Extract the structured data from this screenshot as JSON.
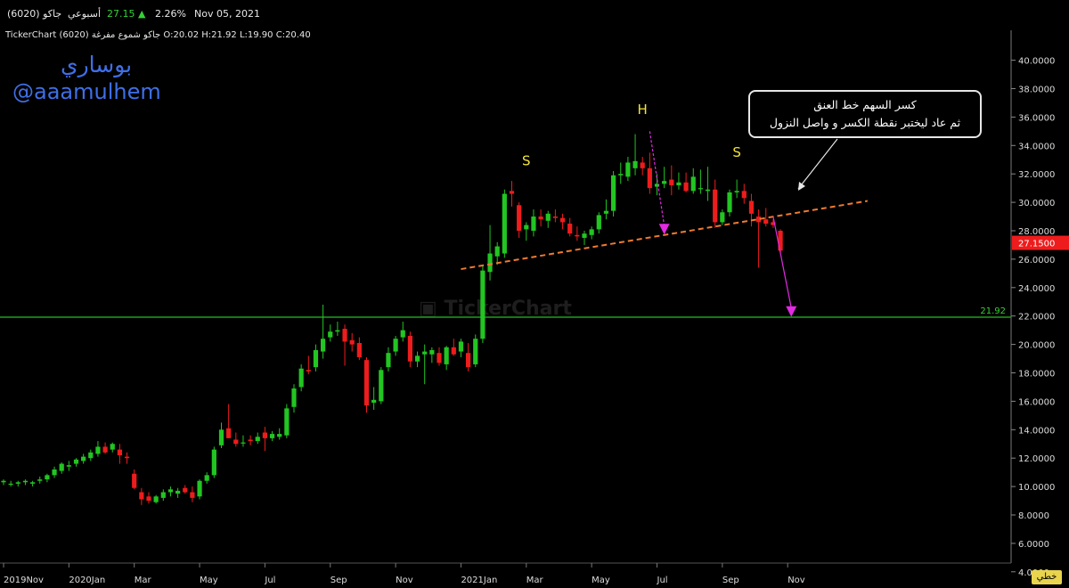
{
  "header": {
    "symbol": "(6020) جاكو",
    "timeframe": "أسبوعي",
    "price": "27.15",
    "change_pct": "2.26%",
    "date": "Nov 05, 2021",
    "ohlc": "TickerChart جاكو شموع مفرغة (6020) O:20.02 H:21.92 L:19.90 C:20.40"
  },
  "watermark": {
    "name": "بوساري",
    "handle": "@aaamulhem"
  },
  "callout": {
    "line1": "كسر السهم خط العنق",
    "line2": "ثم عاد ليختبر نقطة الكسر و واصل النزول"
  },
  "colors": {
    "up": "#22c522",
    "down": "#ee1c1c",
    "background": "#000000",
    "hline": "#1ea01e",
    "trend": "#f07a30",
    "arrow": "#e22be2",
    "letters": "#f2e33a",
    "price_tag": "#ee1c1c"
  },
  "bottom_button": "خطي",
  "chart_data": {
    "type": "candlestick",
    "title": "",
    "xlabel": "",
    "ylabel": "",
    "ylim": [
      3,
      41
    ],
    "y_ticks": [
      "4.0000",
      "6.0000",
      "8.0000",
      "10.0000",
      "12.0000",
      "14.0000",
      "16.0000",
      "18.0000",
      "20.0000",
      "22.0000",
      "24.0000",
      "26.0000",
      "28.0000",
      "30.0000",
      "32.0000",
      "34.0000",
      "36.0000",
      "38.0000",
      "40.0000"
    ],
    "x_ticks": [
      "2019Nov",
      "2020Jan",
      "Mar",
      "May",
      "Jul",
      "Sep",
      "Nov",
      "2021Jan",
      "Mar",
      "May",
      "Jul",
      "Sep",
      "Nov"
    ],
    "last_price_label": "27.1500",
    "horizontal_line": {
      "value": 21.92,
      "label": "21.92"
    },
    "pattern_labels": [
      {
        "text": "S",
        "x_week": 72,
        "y": 32.6
      },
      {
        "text": "H",
        "x_week": 88,
        "y": 36.2
      },
      {
        "text": "S",
        "x_week": 101,
        "y": 33.2
      }
    ],
    "neckline": {
      "from": [
        63,
        25.3
      ],
      "to": [
        119,
        30.1
      ]
    },
    "arrows": [
      {
        "from": [
          89,
          35.0
        ],
        "to": [
          91,
          27.8
        ]
      },
      {
        "from": [
          106,
          29.0
        ],
        "to": [
          108.5,
          22.0
        ]
      }
    ],
    "candles": [
      {
        "o": 10.3,
        "h": 10.5,
        "l": 10.1,
        "c": 10.4
      },
      {
        "o": 10.2,
        "h": 10.4,
        "l": 10.0,
        "c": 10.2
      },
      {
        "o": 10.2,
        "h": 10.4,
        "l": 10.0,
        "c": 10.3
      },
      {
        "o": 10.3,
        "h": 10.5,
        "l": 10.1,
        "c": 10.4
      },
      {
        "o": 10.2,
        "h": 10.4,
        "l": 10.0,
        "c": 10.3
      },
      {
        "o": 10.4,
        "h": 10.7,
        "l": 10.2,
        "c": 10.5
      },
      {
        "o": 10.5,
        "h": 10.9,
        "l": 10.3,
        "c": 10.8
      },
      {
        "o": 10.8,
        "h": 11.4,
        "l": 10.6,
        "c": 11.2
      },
      {
        "o": 11.1,
        "h": 11.7,
        "l": 10.9,
        "c": 11.6
      },
      {
        "o": 11.4,
        "h": 11.8,
        "l": 11.1,
        "c": 11.5
      },
      {
        "o": 11.6,
        "h": 12.0,
        "l": 11.4,
        "c": 11.9
      },
      {
        "o": 11.8,
        "h": 12.3,
        "l": 11.6,
        "c": 12.1
      },
      {
        "o": 12.0,
        "h": 12.6,
        "l": 11.8,
        "c": 12.4
      },
      {
        "o": 12.3,
        "h": 13.2,
        "l": 12.1,
        "c": 12.8
      },
      {
        "o": 12.8,
        "h": 13.1,
        "l": 12.3,
        "c": 12.4
      },
      {
        "o": 12.6,
        "h": 13.1,
        "l": 12.4,
        "c": 13.0
      },
      {
        "o": 12.6,
        "h": 13.0,
        "l": 11.6,
        "c": 12.2
      },
      {
        "o": 12.1,
        "h": 12.4,
        "l": 11.6,
        "c": 12.0
      },
      {
        "o": 10.9,
        "h": 11.2,
        "l": 9.8,
        "c": 9.9
      },
      {
        "o": 9.6,
        "h": 9.9,
        "l": 8.7,
        "c": 9.1
      },
      {
        "o": 9.3,
        "h": 9.6,
        "l": 8.8,
        "c": 9.0
      },
      {
        "o": 8.9,
        "h": 9.4,
        "l": 8.8,
        "c": 9.3
      },
      {
        "o": 9.2,
        "h": 9.8,
        "l": 9.0,
        "c": 9.6
      },
      {
        "o": 9.6,
        "h": 10.0,
        "l": 9.3,
        "c": 9.8
      },
      {
        "o": 9.5,
        "h": 9.9,
        "l": 9.2,
        "c": 9.7
      },
      {
        "o": 9.9,
        "h": 10.1,
        "l": 9.5,
        "c": 9.6
      },
      {
        "o": 9.6,
        "h": 10.0,
        "l": 8.9,
        "c": 9.2
      },
      {
        "o": 9.3,
        "h": 10.5,
        "l": 9.1,
        "c": 10.4
      },
      {
        "o": 10.4,
        "h": 11.0,
        "l": 10.2,
        "c": 10.8
      },
      {
        "o": 10.8,
        "h": 12.8,
        "l": 10.6,
        "c": 12.6
      },
      {
        "o": 12.9,
        "h": 14.5,
        "l": 12.7,
        "c": 14.0
      },
      {
        "o": 14.1,
        "h": 15.8,
        "l": 13.4,
        "c": 13.4
      },
      {
        "o": 13.3,
        "h": 13.8,
        "l": 12.8,
        "c": 13.0
      },
      {
        "o": 13.1,
        "h": 13.6,
        "l": 12.8,
        "c": 13.1
      },
      {
        "o": 13.3,
        "h": 13.6,
        "l": 12.9,
        "c": 13.2
      },
      {
        "o": 13.2,
        "h": 13.8,
        "l": 13.0,
        "c": 13.5
      },
      {
        "o": 13.8,
        "h": 14.2,
        "l": 12.5,
        "c": 13.4
      },
      {
        "o": 13.4,
        "h": 13.9,
        "l": 13.2,
        "c": 13.7
      },
      {
        "o": 13.5,
        "h": 14.1,
        "l": 13.3,
        "c": 13.7
      },
      {
        "o": 13.6,
        "h": 15.8,
        "l": 13.4,
        "c": 15.5
      },
      {
        "o": 15.6,
        "h": 17.2,
        "l": 15.2,
        "c": 16.9
      },
      {
        "o": 17.0,
        "h": 18.6,
        "l": 16.7,
        "c": 18.3
      },
      {
        "o": 18.2,
        "h": 19.2,
        "l": 17.9,
        "c": 18.1
      },
      {
        "o": 18.4,
        "h": 20.0,
        "l": 18.1,
        "c": 19.6
      },
      {
        "o": 19.5,
        "h": 22.8,
        "l": 19.0,
        "c": 20.4
      },
      {
        "o": 20.5,
        "h": 21.4,
        "l": 20.2,
        "c": 20.9
      },
      {
        "o": 20.9,
        "h": 21.6,
        "l": 20.6,
        "c": 21.0
      },
      {
        "o": 21.1,
        "h": 21.4,
        "l": 18.5,
        "c": 20.2
      },
      {
        "o": 20.3,
        "h": 20.8,
        "l": 19.5,
        "c": 20.0
      },
      {
        "o": 20.1,
        "h": 20.5,
        "l": 18.9,
        "c": 19.1
      },
      {
        "o": 18.9,
        "h": 19.1,
        "l": 15.2,
        "c": 15.7
      },
      {
        "o": 15.9,
        "h": 17.0,
        "l": 15.4,
        "c": 16.1
      },
      {
        "o": 16.0,
        "h": 18.4,
        "l": 15.8,
        "c": 18.2
      },
      {
        "o": 18.4,
        "h": 19.8,
        "l": 18.1,
        "c": 19.4
      },
      {
        "o": 19.5,
        "h": 20.6,
        "l": 19.2,
        "c": 20.4
      },
      {
        "o": 20.5,
        "h": 21.6,
        "l": 20.2,
        "c": 21.0
      },
      {
        "o": 20.6,
        "h": 20.9,
        "l": 18.4,
        "c": 18.8
      },
      {
        "o": 18.8,
        "h": 19.5,
        "l": 18.4,
        "c": 19.2
      },
      {
        "o": 19.3,
        "h": 20.0,
        "l": 17.2,
        "c": 19.5
      },
      {
        "o": 19.3,
        "h": 19.8,
        "l": 18.7,
        "c": 19.6
      },
      {
        "o": 19.4,
        "h": 19.8,
        "l": 18.5,
        "c": 18.7
      },
      {
        "o": 18.6,
        "h": 19.9,
        "l": 18.2,
        "c": 19.8
      },
      {
        "o": 19.8,
        "h": 20.4,
        "l": 19.2,
        "c": 19.3
      },
      {
        "o": 19.5,
        "h": 20.4,
        "l": 19.1,
        "c": 20.2
      },
      {
        "o": 19.4,
        "h": 20.1,
        "l": 18.1,
        "c": 18.4
      },
      {
        "o": 18.6,
        "h": 20.7,
        "l": 18.4,
        "c": 20.4
      },
      {
        "o": 20.4,
        "h": 25.5,
        "l": 20.1,
        "c": 25.2
      },
      {
        "o": 25.1,
        "h": 28.4,
        "l": 24.5,
        "c": 26.4
      },
      {
        "o": 26.2,
        "h": 27.2,
        "l": 25.6,
        "c": 26.9
      },
      {
        "o": 26.4,
        "h": 30.9,
        "l": 26.1,
        "c": 30.6
      },
      {
        "o": 30.8,
        "h": 31.5,
        "l": 29.7,
        "c": 30.6
      },
      {
        "o": 29.8,
        "h": 30.0,
        "l": 27.5,
        "c": 28.0
      },
      {
        "o": 28.1,
        "h": 28.6,
        "l": 27.3,
        "c": 28.4
      },
      {
        "o": 28.0,
        "h": 29.5,
        "l": 27.6,
        "c": 29.0
      },
      {
        "o": 29.0,
        "h": 29.5,
        "l": 28.3,
        "c": 28.8
      },
      {
        "o": 28.7,
        "h": 29.4,
        "l": 28.2,
        "c": 29.2
      },
      {
        "o": 29.0,
        "h": 29.5,
        "l": 28.6,
        "c": 28.9
      },
      {
        "o": 28.9,
        "h": 29.2,
        "l": 28.1,
        "c": 28.6
      },
      {
        "o": 28.5,
        "h": 28.9,
        "l": 27.6,
        "c": 27.8
      },
      {
        "o": 27.7,
        "h": 28.3,
        "l": 27.3,
        "c": 27.6
      },
      {
        "o": 27.5,
        "h": 28.0,
        "l": 27.0,
        "c": 27.8
      },
      {
        "o": 27.7,
        "h": 28.3,
        "l": 27.4,
        "c": 28.1
      },
      {
        "o": 28.1,
        "h": 29.3,
        "l": 27.8,
        "c": 29.1
      },
      {
        "o": 29.2,
        "h": 30.2,
        "l": 28.8,
        "c": 29.4
      },
      {
        "o": 29.4,
        "h": 32.2,
        "l": 29.0,
        "c": 31.9
      },
      {
        "o": 31.9,
        "h": 32.8,
        "l": 31.3,
        "c": 32.0
      },
      {
        "o": 31.8,
        "h": 33.2,
        "l": 31.5,
        "c": 32.8
      },
      {
        "o": 32.4,
        "h": 34.8,
        "l": 31.9,
        "c": 32.9
      },
      {
        "o": 32.8,
        "h": 33.2,
        "l": 31.9,
        "c": 32.4
      },
      {
        "o": 32.4,
        "h": 33.5,
        "l": 30.6,
        "c": 31.0
      },
      {
        "o": 31.1,
        "h": 32.0,
        "l": 30.5,
        "c": 31.3
      },
      {
        "o": 31.3,
        "h": 32.5,
        "l": 31.0,
        "c": 31.5
      },
      {
        "o": 31.6,
        "h": 32.6,
        "l": 30.5,
        "c": 31.2
      },
      {
        "o": 31.2,
        "h": 32.1,
        "l": 30.9,
        "c": 31.4
      },
      {
        "o": 31.4,
        "h": 32.1,
        "l": 30.7,
        "c": 30.8
      },
      {
        "o": 30.8,
        "h": 32.4,
        "l": 30.6,
        "c": 31.8
      },
      {
        "o": 31.0,
        "h": 32.3,
        "l": 30.6,
        "c": 31.0
      },
      {
        "o": 30.8,
        "h": 32.5,
        "l": 30.1,
        "c": 30.9
      },
      {
        "o": 30.9,
        "h": 31.6,
        "l": 28.2,
        "c": 28.6
      },
      {
        "o": 28.6,
        "h": 29.5,
        "l": 28.4,
        "c": 29.3
      },
      {
        "o": 29.3,
        "h": 30.9,
        "l": 29.0,
        "c": 30.7
      },
      {
        "o": 30.7,
        "h": 31.6,
        "l": 30.3,
        "c": 30.8
      },
      {
        "o": 30.8,
        "h": 31.3,
        "l": 29.9,
        "c": 30.3
      },
      {
        "o": 30.1,
        "h": 30.6,
        "l": 28.3,
        "c": 29.2
      },
      {
        "o": 29.0,
        "h": 29.5,
        "l": 25.4,
        "c": 28.6
      },
      {
        "o": 28.8,
        "h": 29.6,
        "l": 28.3,
        "c": 28.5
      },
      {
        "o": 28.6,
        "h": 28.8,
        "l": 28.2,
        "c": 28.4
      },
      {
        "o": 28.0,
        "h": 28.1,
        "l": 26.4,
        "c": 26.6
      }
    ]
  }
}
